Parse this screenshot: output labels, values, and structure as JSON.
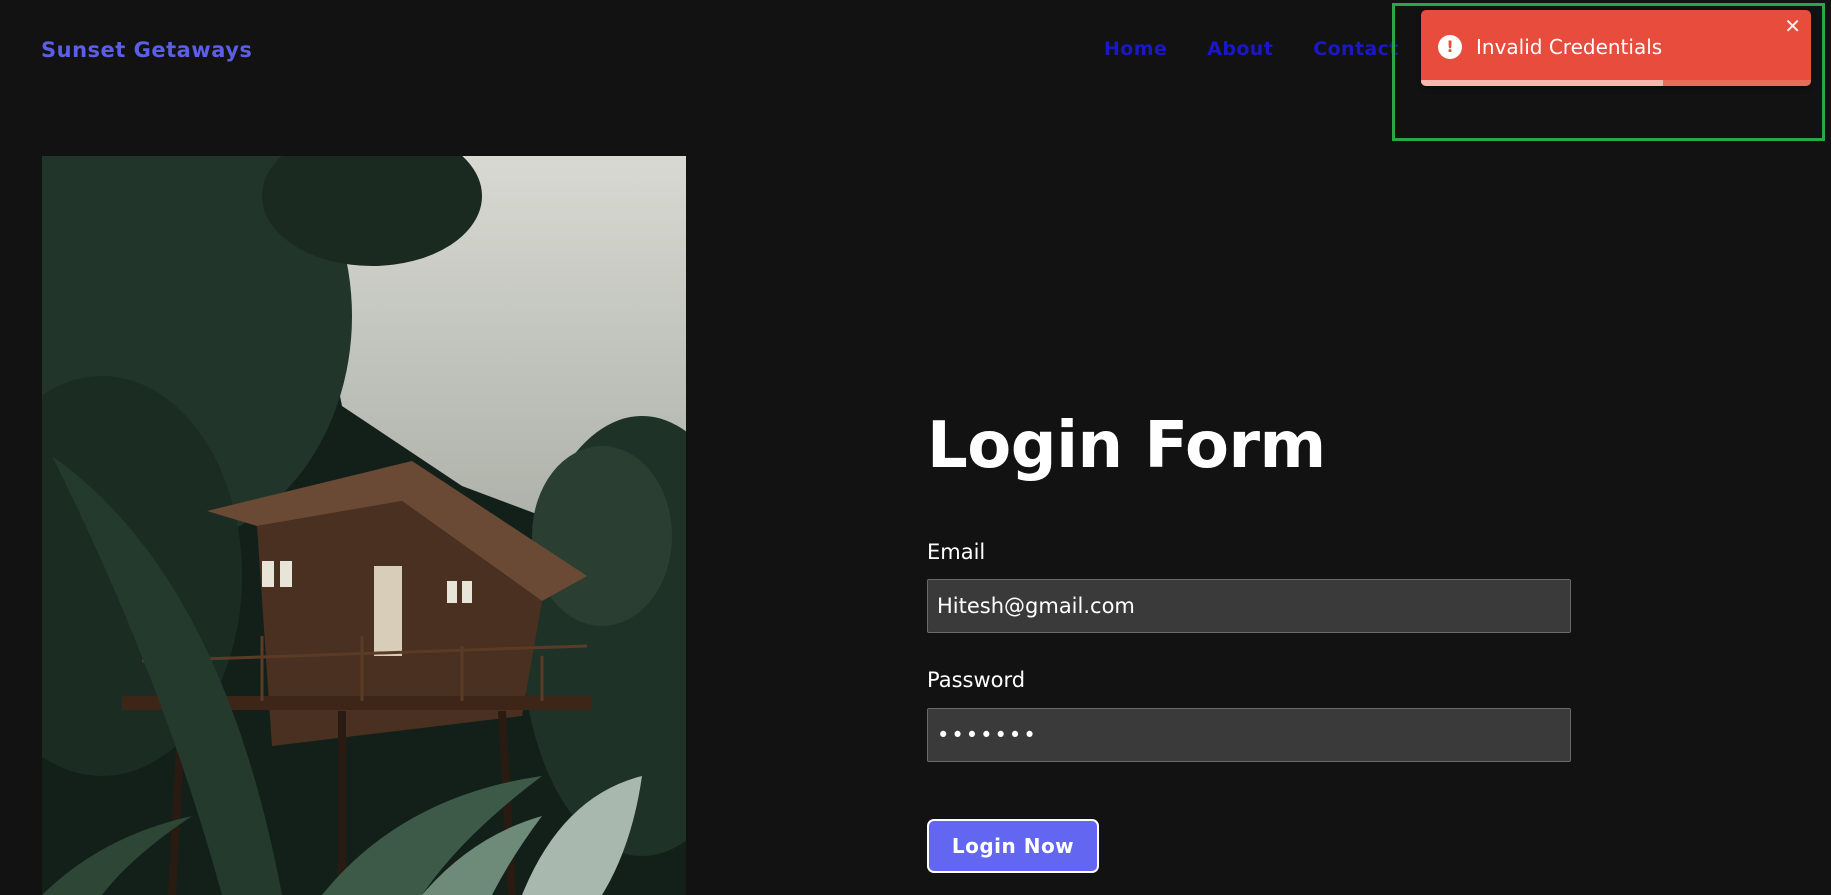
{
  "header": {
    "brand": "Sunset Getaways",
    "nav": [
      "Home",
      "About",
      "Contact"
    ]
  },
  "form": {
    "title": "Login Form",
    "email_label": "Email",
    "email_value": "Hitesh@gmail.com",
    "password_label": "Password",
    "password_value": "•••••••",
    "submit_label": "Login Now"
  },
  "toast": {
    "message": "Invalid Credentials",
    "icon": "error-icon",
    "close_icon": "close-icon",
    "progress": 0.62,
    "color": "#e74c3c"
  },
  "photo": {
    "subject": "treehouse-in-forest-image"
  },
  "colors": {
    "background": "#121212",
    "brand": "#5b5ee6",
    "nav_link": "#1a17c9",
    "button": "#6366f1",
    "highlight": "#27a745"
  }
}
